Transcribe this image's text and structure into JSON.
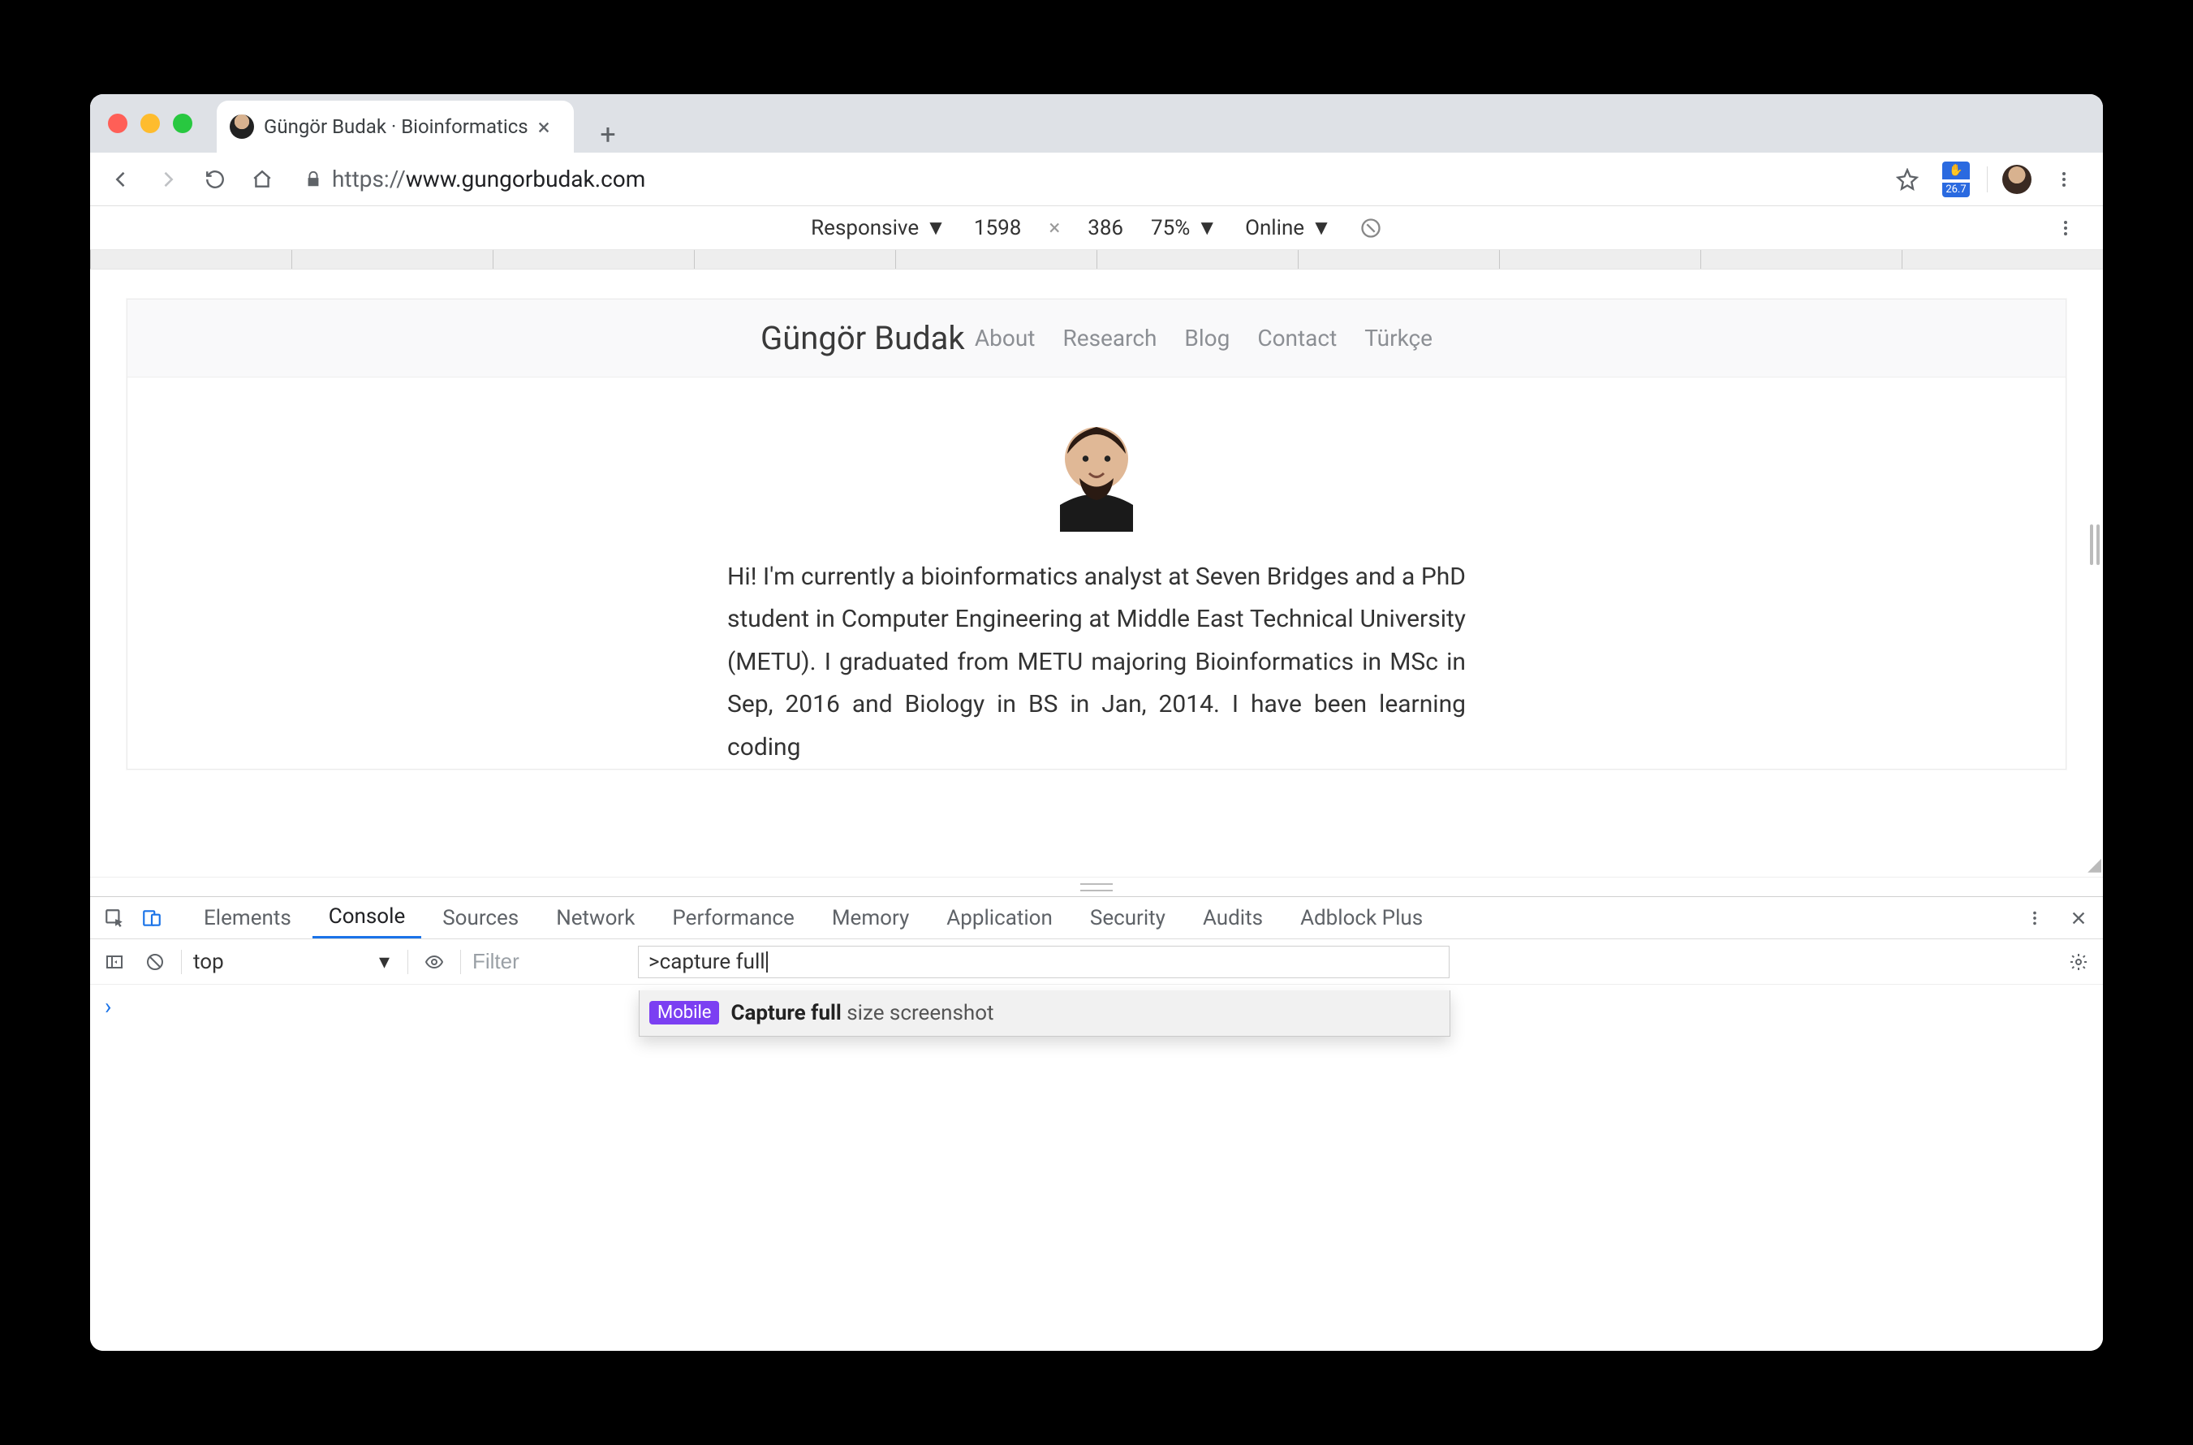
{
  "tab": {
    "title": "Güngör Budak · Bioinformatics"
  },
  "omnibox": {
    "protocol": "https://",
    "host": "www.gungorbudak.com"
  },
  "abp": {
    "count": "26.7"
  },
  "device_bar": {
    "mode": "Responsive",
    "width": "1598",
    "height": "386",
    "zoom": "75%",
    "network": "Online"
  },
  "site": {
    "title": "Güngör Budak",
    "nav": [
      "About",
      "Research",
      "Blog",
      "Contact",
      "Türkçe"
    ],
    "intro": "Hi! I'm currently a bioinformatics analyst at Seven Bridges and a PhD student in Computer Engineering at Middle East Technical University (METU). I graduated from METU majoring Bioinformatics in MSc in Sep, 2016 and Biology in BS in Jan, 2014. I have been learning coding"
  },
  "devtools": {
    "tabs": [
      "Elements",
      "Console",
      "Sources",
      "Network",
      "Performance",
      "Memory",
      "Application",
      "Security",
      "Audits",
      "Adblock Plus"
    ],
    "active_tab": "Console",
    "context": "top",
    "filter_placeholder": "Filter",
    "command_input": ">capture full",
    "suggestion": {
      "badge": "Mobile",
      "bold": "Capture full",
      "rest": " size screenshot"
    }
  }
}
